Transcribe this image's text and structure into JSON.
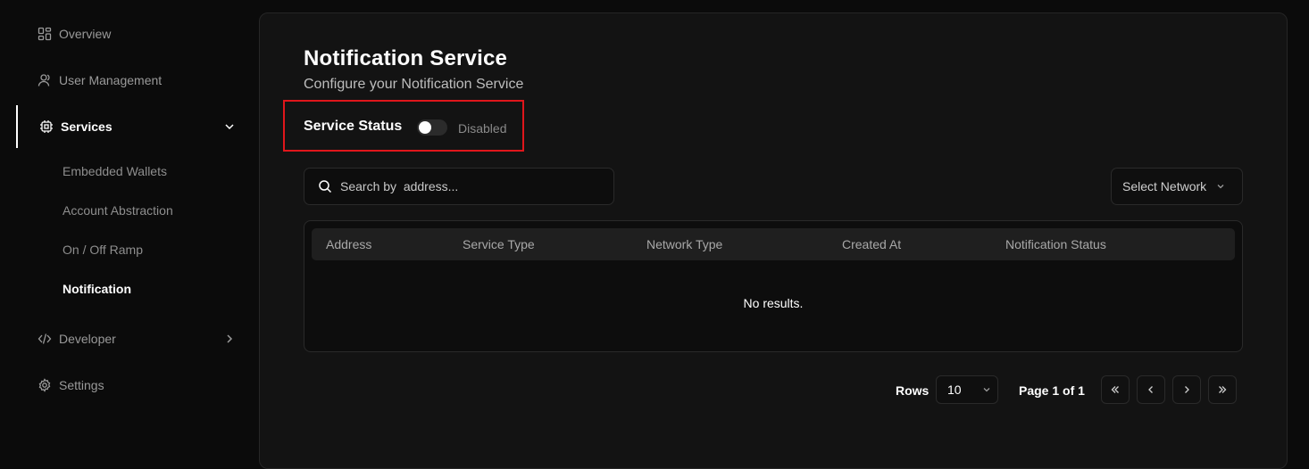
{
  "sidebar": {
    "items": [
      {
        "label": "Overview",
        "icon": "dashboard-icon"
      },
      {
        "label": "User Management",
        "icon": "user-icon"
      },
      {
        "label": "Services",
        "icon": "chip-icon",
        "expanded": true
      },
      {
        "label": "Developer",
        "icon": "code-icon"
      },
      {
        "label": "Settings",
        "icon": "gear-icon"
      }
    ],
    "services_children": [
      {
        "label": "Embedded Wallets"
      },
      {
        "label": "Account Abstraction"
      },
      {
        "label": "On / Off Ramp"
      },
      {
        "label": "Notification",
        "active": true
      }
    ]
  },
  "page": {
    "title": "Notification Service",
    "subtitle": "Configure your Notification Service",
    "status_label": "Service Status",
    "status_value": "Disabled",
    "toggle_on": false
  },
  "search": {
    "placeholder": "Search by  address..."
  },
  "network_select": {
    "label": "Select Network"
  },
  "table": {
    "columns": [
      "Address",
      "Service Type",
      "Network Type",
      "Created At",
      "Notification Status"
    ],
    "rows": [],
    "empty_text": "No results."
  },
  "pagination": {
    "rows_label": "Rows",
    "rows_value": "10",
    "page_info": "Page 1 of 1"
  },
  "colors": {
    "background": "#0b0b0b",
    "panel": "#131313",
    "highlight_border": "#e0161b"
  }
}
